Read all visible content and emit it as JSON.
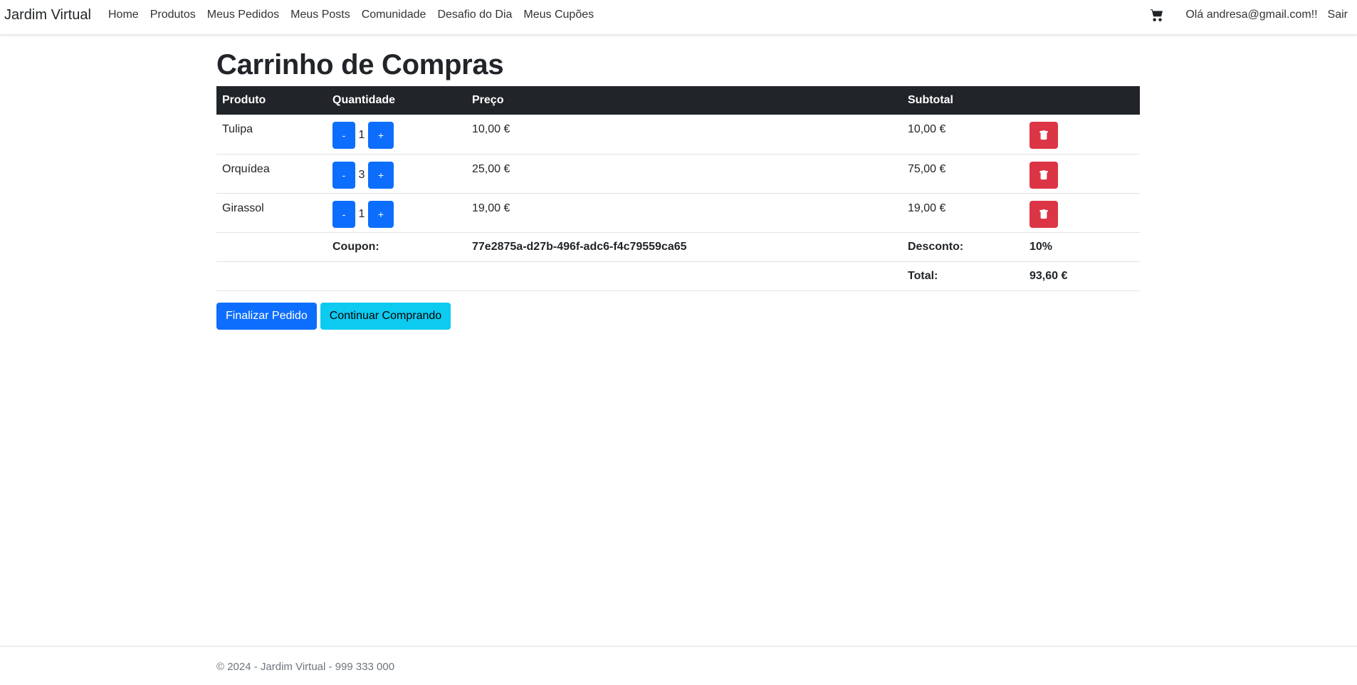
{
  "navbar": {
    "brand": "Jardim Virtual",
    "links": [
      "Home",
      "Produtos",
      "Meus Pedidos",
      "Meus Posts",
      "Comunidade",
      "Desafio do Dia",
      "Meus Cupões"
    ],
    "greeting": "Olá andresa@gmail.com!!",
    "logout": "Sair",
    "cart_icon": "cart-icon"
  },
  "page": {
    "title": "Carrinho de Compras"
  },
  "table": {
    "headers": [
      "Produto",
      "Quantidade",
      "Preço",
      "Subtotal",
      ""
    ],
    "items": [
      {
        "product": "Tulipa",
        "quantity": "1",
        "price": "10,00 €",
        "subtotal": "10,00 €"
      },
      {
        "product": "Orquídea",
        "quantity": "3",
        "price": "25,00 €",
        "subtotal": "75,00 €"
      },
      {
        "product": "Girassol",
        "quantity": "1",
        "price": "19,00 €",
        "subtotal": "19,00 €"
      }
    ],
    "minus_label": "-",
    "plus_label": "+",
    "coupon_label": "Coupon:",
    "coupon_code": "77e2875a-d27b-496f-adc6-f4c79559ca65",
    "discount_label": "Desconto:",
    "discount_value": "10%",
    "total_label": "Total:",
    "total_value": "93,60 €"
  },
  "actions": {
    "checkout": "Finalizar Pedido",
    "continue": "Continuar Comprando"
  },
  "footer": {
    "text": "© 2024 - Jardim Virtual - 999 333 000"
  },
  "colors": {
    "primary": "#0d6efd",
    "info": "#0dcaf0",
    "danger": "#dc3545",
    "header_dark": "#212529"
  }
}
